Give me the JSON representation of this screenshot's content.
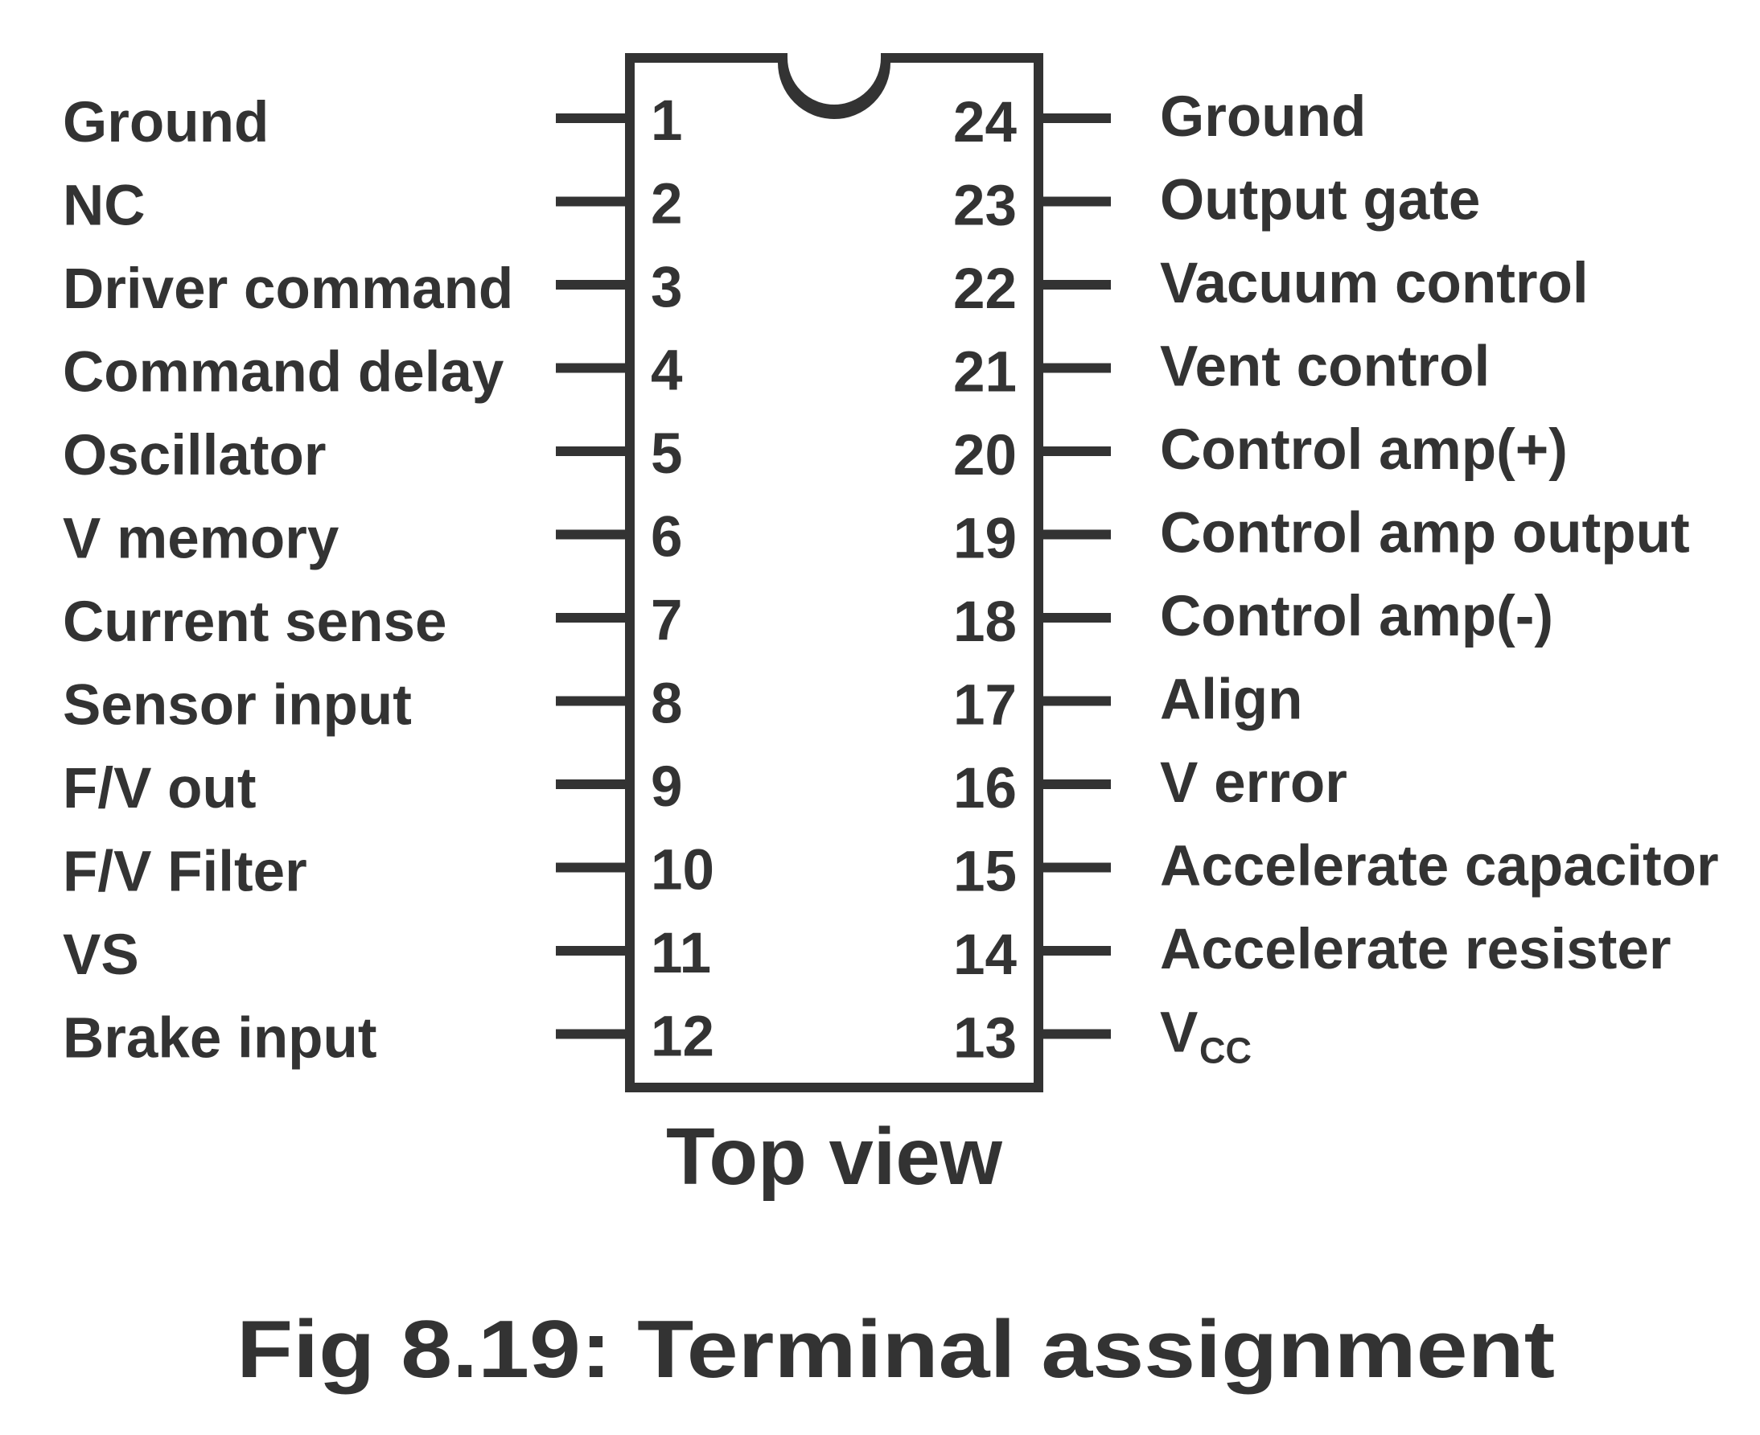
{
  "figure": {
    "caption": "Fig 8.19: Terminal assignment",
    "view_label": "Top view",
    "ink_color": "#333333",
    "background_color": "#ffffff"
  },
  "ic": {
    "pin_count": 24,
    "left_pins": [
      {
        "number": "1",
        "label": "Ground"
      },
      {
        "number": "2",
        "label": "NC"
      },
      {
        "number": "3",
        "label": "Driver command"
      },
      {
        "number": "4",
        "label": "Command delay"
      },
      {
        "number": "5",
        "label": "Oscillator"
      },
      {
        "number": "6",
        "label": "V memory"
      },
      {
        "number": "7",
        "label": "Current sense"
      },
      {
        "number": "8",
        "label": "Sensor input"
      },
      {
        "number": "9",
        "label": "F/V out"
      },
      {
        "number": "10",
        "label": "F/V Filter"
      },
      {
        "number": "11",
        "label": "VS"
      },
      {
        "number": "12",
        "label": "Brake input"
      }
    ],
    "right_pins": [
      {
        "number": "24",
        "label": "Ground"
      },
      {
        "number": "23",
        "label": "Output gate"
      },
      {
        "number": "22",
        "label": "Vacuum control"
      },
      {
        "number": "21",
        "label": "Vent control"
      },
      {
        "number": "20",
        "label": "Control amp(+)"
      },
      {
        "number": "19",
        "label": "Control amp output"
      },
      {
        "number": "18",
        "label": "Control amp(-)"
      },
      {
        "number": "17",
        "label": "Align"
      },
      {
        "number": "16",
        "label": "V error"
      },
      {
        "number": "15",
        "label": "Accelerate capacitor"
      },
      {
        "number": "14",
        "label": "Accelerate resister"
      },
      {
        "number": "13",
        "label": "V",
        "label_subscript": "CC"
      }
    ]
  }
}
